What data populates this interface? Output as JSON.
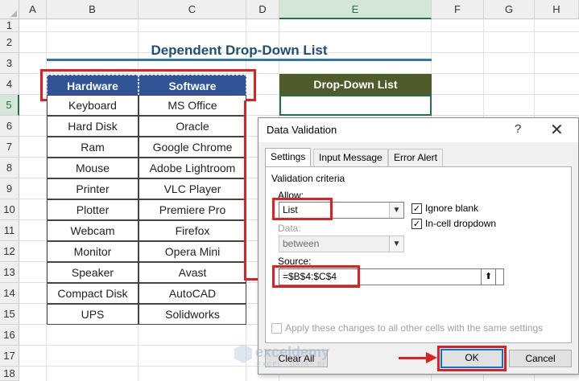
{
  "sheet": {
    "columns": [
      "A",
      "B",
      "C",
      "D",
      "E",
      "F",
      "G",
      "H"
    ],
    "rows": [
      "1",
      "2",
      "3",
      "4",
      "5",
      "6",
      "7",
      "8",
      "9",
      "10",
      "11",
      "12",
      "13",
      "14",
      "15",
      "16",
      "17",
      "18"
    ],
    "title": "Dependent Drop-Down List",
    "table_headers": {
      "hardware": "Hardware",
      "software": "Software"
    },
    "table_rows": [
      {
        "hardware": "Keyboard",
        "software": "MS Office"
      },
      {
        "hardware": "Hard Disk",
        "software": "Oracle"
      },
      {
        "hardware": "Ram",
        "software": "Google Chrome"
      },
      {
        "hardware": "Mouse",
        "software": "Adobe Lightroom"
      },
      {
        "hardware": "Printer",
        "software": "VLC Player"
      },
      {
        "hardware": "Plotter",
        "software": "Premiere Pro"
      },
      {
        "hardware": "Webcam",
        "software": "Firefox"
      },
      {
        "hardware": "Monitor",
        "software": "Opera Mini"
      },
      {
        "hardware": "Speaker",
        "software": "Avast"
      },
      {
        "hardware": "Compact Disk",
        "software": "AutoCAD"
      },
      {
        "hardware": "UPS",
        "software": "Solidworks"
      }
    ],
    "dropdown_header": "Drop-Down List",
    "selected_column": "E",
    "selected_row": "5"
  },
  "dialog": {
    "title": "Data Validation",
    "help": "?",
    "close": "✕",
    "tabs": [
      "Settings",
      "Input Message",
      "Error Alert"
    ],
    "active_tab": "Settings",
    "section_label": "Validation criteria",
    "allow_label": "Allow:",
    "allow_value": "List",
    "ignore_blank_label": "Ignore blank",
    "ignore_blank_checked": true,
    "in_cell_dropdown_label": "In-cell dropdown",
    "in_cell_dropdown_checked": true,
    "data_label": "Data:",
    "data_value": "between",
    "source_label": "Source:",
    "source_value": "=$B$4:$C$4",
    "apply_all_label": "Apply these changes to all other cells with the same settings",
    "apply_all_checked": false,
    "clear_all_label": "Clear All",
    "ok_label": "OK",
    "cancel_label": "Cancel"
  },
  "watermark": {
    "name": "exceldemy",
    "tagline": "EXCEL · DATA · BI"
  },
  "colors": {
    "accent_red": "#e02020",
    "table_header": "#305496",
    "dropdown_header": "#4f5b2a",
    "excel_green": "#217346"
  },
  "icons": {
    "combo": "chevron-down-icon",
    "collapse": "range-collapse-icon",
    "check": "checkmark-icon"
  }
}
